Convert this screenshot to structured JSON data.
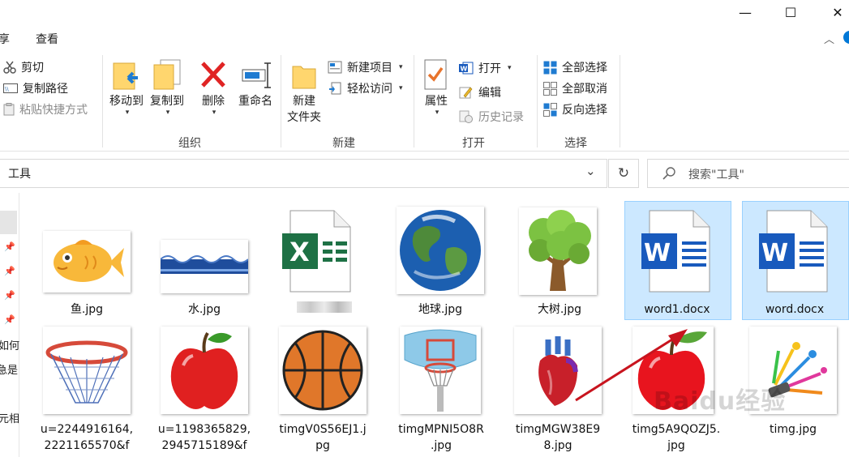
{
  "window": {
    "minimize": "—",
    "maximize": "☐",
    "close": "✕"
  },
  "menu_tabs": [
    "享",
    "查看"
  ],
  "ribbon": {
    "clipboard": {
      "cut": "剪切",
      "copy_path": "复制路径",
      "paste_shortcut": "粘贴快捷方式"
    },
    "organize": {
      "label": "组织",
      "move_to": "移动到",
      "copy_to": "复制到",
      "delete": "删除",
      "rename": "重命名"
    },
    "new": {
      "label": "新建",
      "new_folder_line1": "新建",
      "new_folder_line2": "文件夹",
      "new_item": "新建项目",
      "easy_access": "轻松访问"
    },
    "open": {
      "label": "打开",
      "properties": "属性",
      "open": "打开",
      "edit": "编辑",
      "history": "历史记录"
    },
    "select": {
      "label": "选择",
      "select_all": "全部选择",
      "select_none": "全部取消",
      "invert": "反向选择"
    }
  },
  "address": {
    "path": "工具",
    "search_placeholder": "搜索\"工具\""
  },
  "nav_partial": [
    "如何",
    "急是",
    "元相"
  ],
  "files_row1": [
    {
      "name": "鱼.jpg"
    },
    {
      "name": "水.jpg"
    },
    {
      "name": ""
    },
    {
      "name": "地球.jpg"
    },
    {
      "name": "大树.jpg"
    },
    {
      "name": "word1.docx"
    },
    {
      "name": "word.docx"
    }
  ],
  "files_row2": [
    {
      "l1": "u=2244916164,",
      "l2": "2221165570&f"
    },
    {
      "l1": "u=1198365829,",
      "l2": "2945715189&f"
    },
    {
      "l1": "timgV0S56EJ1.j",
      "l2": "pg"
    },
    {
      "l1": "timgMPNI5O8R",
      "l2": ".jpg"
    },
    {
      "l1": "timgMGW38E9",
      "l2": "8.jpg"
    },
    {
      "l1": "timg5A9QOZJ5.",
      "l2": "jpg"
    },
    {
      "l1": "timg.jpg",
      "l2": ""
    }
  ],
  "watermark": "Baidu经验",
  "colors": {
    "selection_bg": "#cce8ff",
    "selection_border": "#99d1ff",
    "word_blue": "#185abd",
    "excel_green": "#1e7145",
    "accent": "#0078d7"
  }
}
